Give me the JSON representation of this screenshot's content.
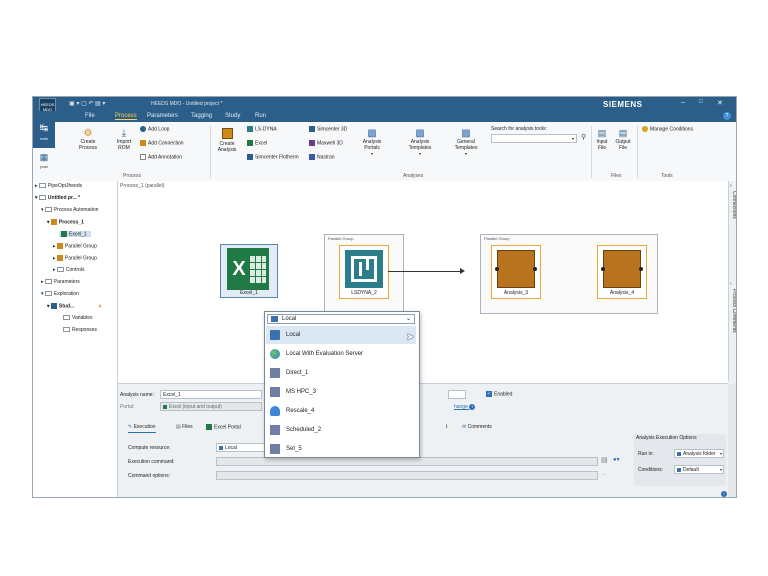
{
  "window": {
    "title": "HEEDS MDO - Untitled project *",
    "brand": "SIEMENS",
    "logo_text": "HEEDS\nMDO"
  },
  "menu": [
    "File",
    "Process",
    "Parameters",
    "Tagging",
    "Study",
    "Run"
  ],
  "ribbon": {
    "mdo_label": "mdo",
    "post_label": "post",
    "create_process": "Create\nProcess",
    "import_rom": "Import\nROM",
    "add_loop": "Add Loop",
    "add_connection": "Add Connection",
    "add_annotation": "Add Annotation",
    "process_group": "Process",
    "create_analysis": "Create\nAnalysis",
    "portals": [
      "LS-DYNA",
      "Excel",
      "Simcenter Flotherm",
      "Simcenter 3D",
      "Maxwell 3D",
      "Nastran"
    ],
    "analysis_portals": "Analysis\nPortals",
    "analysis_templates": "Analysis\nTemplates",
    "general_templates": "General\nTemplates",
    "search_label": "Search for analysis tools:",
    "analyses_group": "Analyses",
    "input_file": "Input\nFile",
    "output_file": "Output\nFile",
    "files_group": "Files",
    "manage_conditions": "Manage Conditions",
    "tools_group": "Tools"
  },
  "tree": [
    "PipeOptJheeds",
    "Untitled pr...",
    "Process Automation",
    "Process_1",
    "Excel_1",
    "Parallel Group",
    "Parallel Group",
    "Controls",
    "Parameters",
    "Exploration",
    "Stud...",
    "Variables",
    "Responses"
  ],
  "canvas": {
    "title": "Process_1 (parallel)",
    "excel_label": "Excel_1",
    "lsdyna_label": "LSDYNA_2",
    "analysis3_label": "Analysis_3",
    "analysis4_label": "Analysis_4",
    "group_label_1": "Parallel Group",
    "group_label_2": "Parallel Group",
    "excel_letter": "X"
  },
  "sidebar_right": [
    "Connections",
    "Process Comments"
  ],
  "bottom": {
    "analysis_name_label": "Analysis name:",
    "analysis_name_value": "Excel_1",
    "portal_label": "Portal:",
    "portal_value": "Excel (input and output)",
    "enabled_label": "Enabled",
    "change_link": "hange",
    "tabs": [
      "Execution",
      "Files",
      "Excel Portal",
      "t",
      "Comments"
    ],
    "compute_resource_label": "Compute resource:",
    "compute_resource_value": "Local",
    "execution_command_label": "Execution command:",
    "command_options_label": "Command options:",
    "options_title": "Analysis Execution Options",
    "run_in_label": "Run in:",
    "run_in_value": "Analysis folder",
    "conditions_label": "Conditions:",
    "conditions_value": "Default"
  },
  "dropdown": {
    "selected": "Local",
    "items": [
      "Local",
      "Local With Evaluation Server",
      "Direct_1",
      "MS HPC_3",
      "Rescale_4",
      "Scheduled_2",
      "Set_5"
    ]
  },
  "colors": {
    "titlebar": "#2b5e89",
    "accent": "#ffd24a",
    "excel_green": "#1f7a45",
    "analysis_brown": "#b8731f",
    "lsdyna_teal": "#2c7d8c",
    "dropdown_selection": "#dbe8f4"
  }
}
